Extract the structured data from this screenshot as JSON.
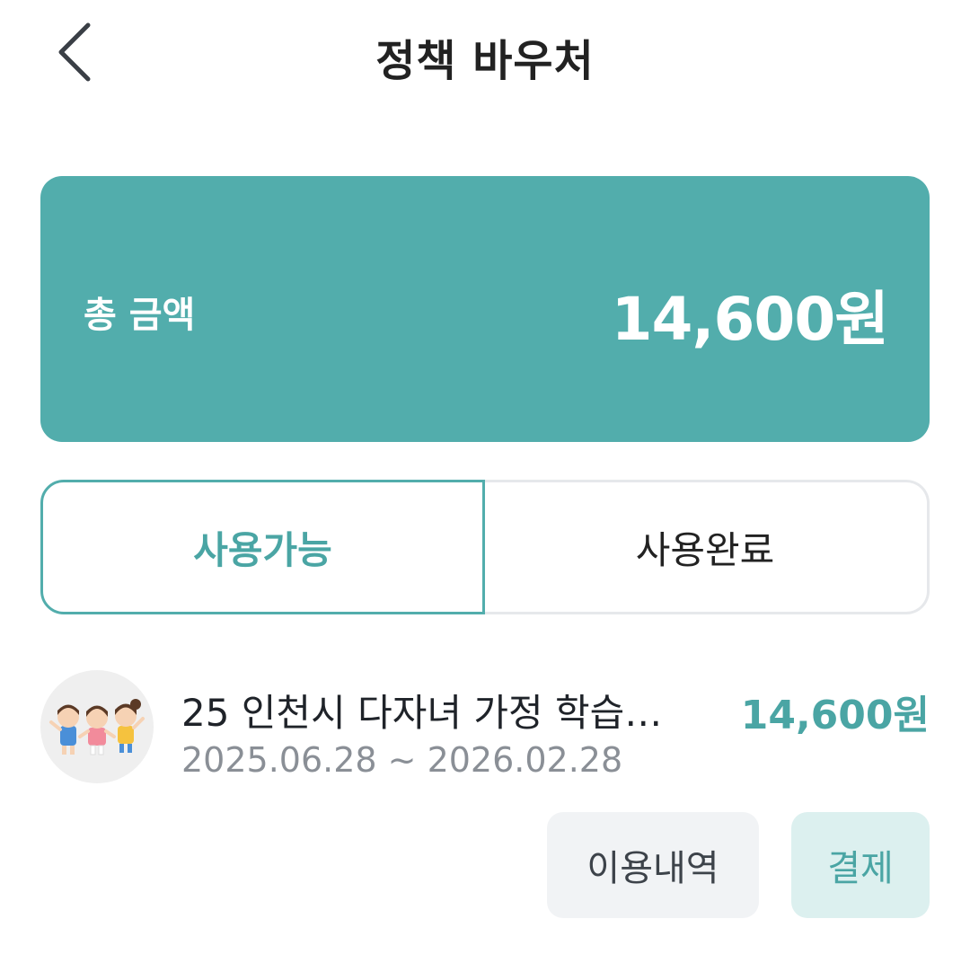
{
  "header": {
    "title": "정책 바우처",
    "back_icon": "chevron-left-icon"
  },
  "summary": {
    "label": "총 금액",
    "amount": "14,600원",
    "card_color": "#52adac"
  },
  "tabs": [
    {
      "label": "사용가능",
      "selected": true
    },
    {
      "label": "사용완료",
      "selected": false
    }
  ],
  "vouchers": [
    {
      "title": "25 인천시 다자녀 가정 학습…",
      "period": "2025.06.28 ~ 2026.02.28",
      "amount": "14,600원",
      "thumbnail_icon": "children-illustration-icon",
      "actions": {
        "history_label": "이용내역",
        "pay_label": "결제"
      }
    }
  ],
  "colors": {
    "accent": "#4aa5a4",
    "text_primary": "#1f2329",
    "text_secondary": "#8a8f96",
    "button_gray": "#f1f3f5",
    "button_mint": "#dcf0ef"
  }
}
